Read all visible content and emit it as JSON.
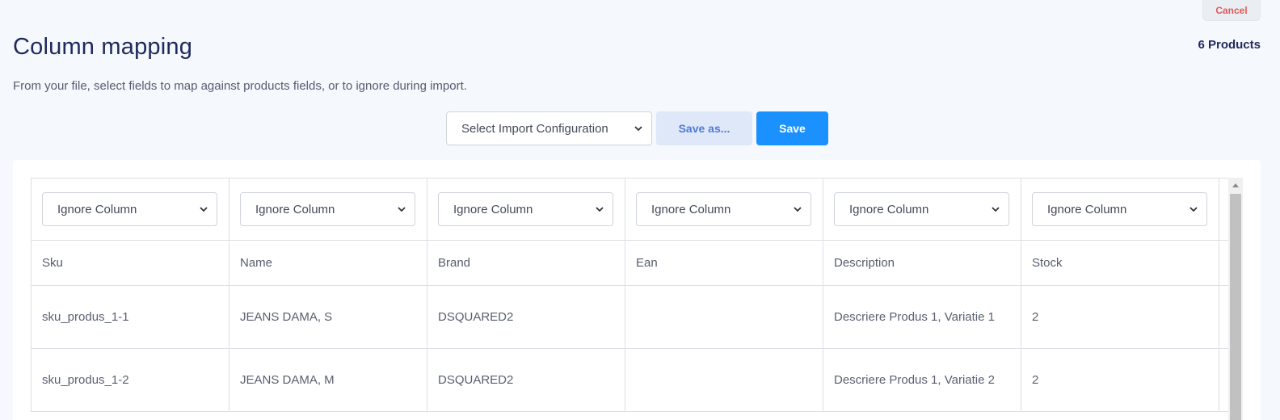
{
  "header": {
    "cancel_label": "Cancel",
    "title": "Column mapping",
    "products_count": "6 Products",
    "subtitle": "From your file, select fields to map against products fields, or to ignore during import."
  },
  "toolbar": {
    "config_select": "Select Import Configuration",
    "save_as_label": "Save as...",
    "save_label": "Save"
  },
  "table": {
    "column_mappings": [
      "Ignore Column",
      "Ignore Column",
      "Ignore Column",
      "Ignore Column",
      "Ignore Column",
      "Ignore Column"
    ],
    "headers": [
      "Sku",
      "Name",
      "Brand",
      "Ean",
      "Description",
      "Stock"
    ],
    "rows": [
      [
        "sku_produs_1-1",
        "JEANS DAMA, S",
        "DSQUARED2",
        "",
        "Descriere Produs 1, Variatie 1",
        "2"
      ],
      [
        "sku_produs_1-2",
        "JEANS DAMA, M",
        "DSQUARED2",
        "",
        "Descriere Produs 1, Variatie 2",
        "2"
      ]
    ]
  },
  "colors": {
    "accent": "#1b91ff",
    "cancel_text": "#e05a5a",
    "title": "#1f2a5c"
  },
  "icons": {
    "select_chevron": "chevron-down-icon",
    "scroll_up": "arrow-up-icon"
  }
}
